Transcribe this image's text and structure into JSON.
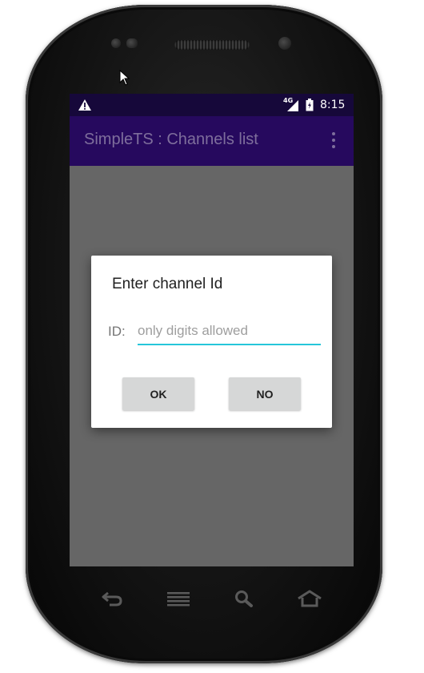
{
  "status_bar": {
    "network": "4G",
    "time": "8:15",
    "icons": [
      "warning-icon",
      "signal-icon",
      "battery-icon"
    ]
  },
  "app_bar": {
    "title": "SimpleTS : Channels list",
    "menu_icon": "overflow-menu-icon"
  },
  "dialog": {
    "title": "Enter channel Id",
    "field_label": "ID:",
    "field_value": "",
    "field_placeholder": "only digits allowed",
    "ok_label": "OK",
    "no_label": "NO"
  },
  "nav_keys": [
    "back-icon",
    "menu-icon",
    "search-icon",
    "home-icon"
  ],
  "colors": {
    "status_bar": "#16083a",
    "app_bar": "#26095e",
    "title_text": "#7e6e9c",
    "scrim": "#666666",
    "accent": "#26c6da",
    "button": "#d6d7d7"
  }
}
